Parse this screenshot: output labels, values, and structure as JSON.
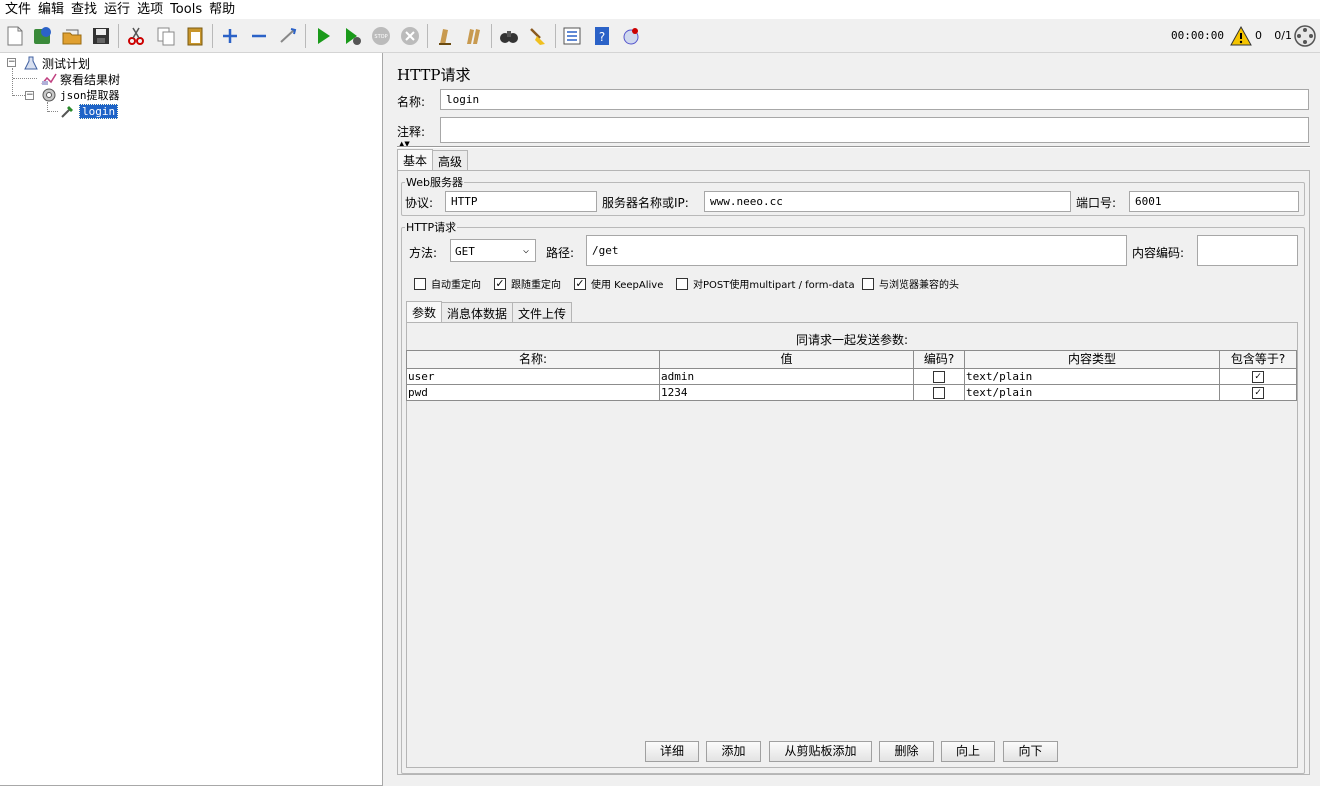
{
  "menu": [
    "文件",
    "编辑",
    "查找",
    "运行",
    "选项",
    "Tools",
    "帮助"
  ],
  "toolbar": {
    "timer": "00:00:00",
    "warnings": "0",
    "threads": "0/1"
  },
  "tree": {
    "plan": "测试计划",
    "listener": "察看结果树",
    "extractor": "json提取器",
    "sampler": "login"
  },
  "panel": {
    "title": "HTTP请求",
    "name_label": "名称:",
    "name_value": "login",
    "comment_label": "注释:",
    "comment_value": "",
    "tabs": [
      "基本",
      "高级"
    ],
    "web_server": {
      "legend": "Web服务器",
      "protocol_label": "协议:",
      "protocol_value": "HTTP",
      "server_label": "服务器名称或IP:",
      "server_value": "www.neeo.cc",
      "port_label": "端口号:",
      "port_value": "6001"
    },
    "http_request": {
      "legend": "HTTP请求",
      "method_label": "方法:",
      "method_value": "GET",
      "path_label": "路径:",
      "path_value": "/get",
      "encoding_label": "内容编码:",
      "encoding_value": ""
    },
    "options": [
      {
        "label": "自动重定向",
        "checked": false
      },
      {
        "label": "跟随重定向",
        "checked": true
      },
      {
        "label": "使用 KeepAlive",
        "checked": true
      },
      {
        "label": "对POST使用multipart / form-data",
        "checked": false
      },
      {
        "label": "与浏览器兼容的头",
        "checked": false
      }
    ],
    "subtabs": [
      "参数",
      "消息体数据",
      "文件上传"
    ],
    "params_caption": "同请求一起发送参数:",
    "columns": [
      "名称:",
      "值",
      "编码?",
      "内容类型",
      "包含等于?"
    ],
    "rows": [
      {
        "name": "user",
        "value": "admin",
        "encode": false,
        "content_type": "text/plain",
        "include_equals": true
      },
      {
        "name": "pwd",
        "value": "1234",
        "encode": false,
        "content_type": "text/plain",
        "include_equals": true
      }
    ],
    "buttons": [
      "详细",
      "添加",
      "从剪贴板添加",
      "删除",
      "向上",
      "向下"
    ]
  }
}
